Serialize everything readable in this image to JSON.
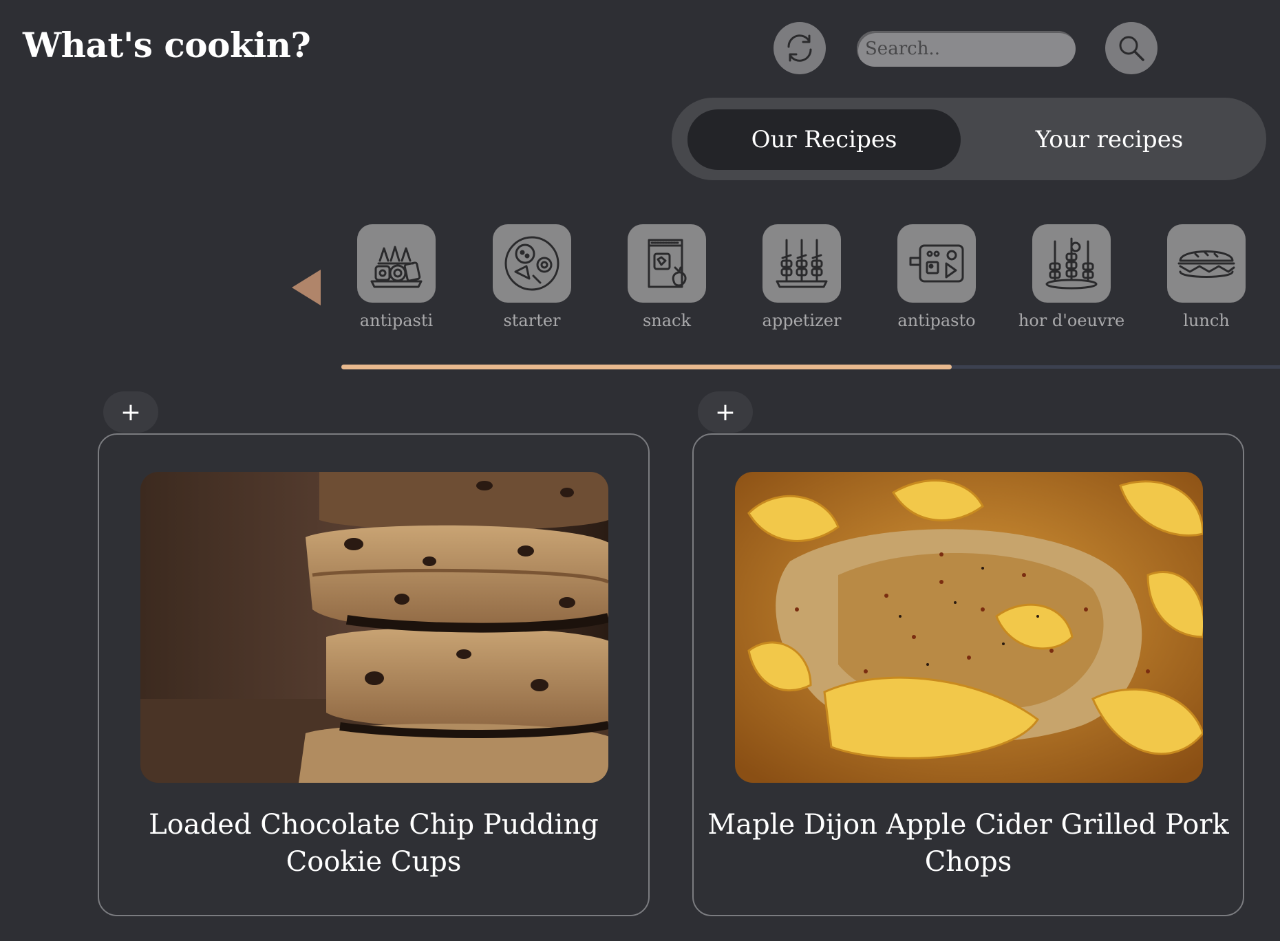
{
  "app": {
    "title": "What's cookin?"
  },
  "header": {
    "refresh_icon": "refresh-icon",
    "search_placeholder": "Search..",
    "search_value": "",
    "search_icon": "search-icon"
  },
  "tabs": [
    {
      "label": "Our Recipes",
      "active": true
    },
    {
      "label": "Your recipes",
      "active": false
    }
  ],
  "categories": {
    "prev_icon": "triangle-left-icon",
    "accent_color": "#b0856a",
    "items": [
      {
        "label": "antipasti",
        "icon": "antipasti-platter-icon"
      },
      {
        "label": "starter",
        "icon": "starter-plate-icon"
      },
      {
        "label": "snack",
        "icon": "snack-bag-icon"
      },
      {
        "label": "appetizer",
        "icon": "skewers-icon"
      },
      {
        "label": "antipasto",
        "icon": "cutting-board-icon"
      },
      {
        "label": "hor d'oeuvre",
        "icon": "canape-tray-icon"
      },
      {
        "label": "lunch",
        "icon": "sandwich-icon"
      }
    ],
    "scroll_progress": 0.65,
    "scroll_color": "#e8b98e"
  },
  "recipes": [
    {
      "title": "Loaded Chocolate Chip Pudding Cookie Cups",
      "add_label": "+",
      "image": "stacked-chocolate-chip-cookies-photo"
    },
    {
      "title": "Maple Dijon Apple Cider Grilled Pork Chops",
      "add_label": "+",
      "image": "glazed-pork-chops-with-apples-photo"
    }
  ]
}
